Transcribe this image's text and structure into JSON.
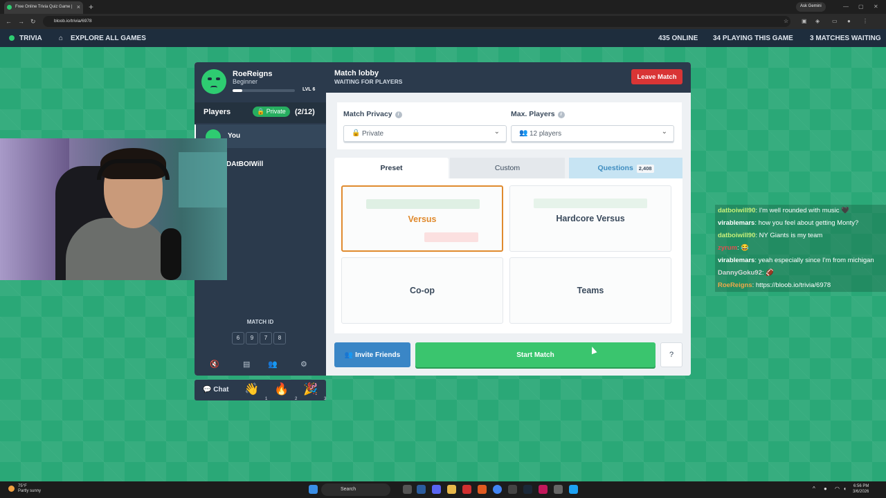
{
  "browser": {
    "tab_title": "Free Online Trivia Quiz Game | ",
    "url": "bloob.io/trivia/6978",
    "gemini_label": "Ask Gemini"
  },
  "site_header": {
    "brand": "TRIVIA",
    "explore": "EXPLORE ALL GAMES",
    "online": "435 ONLINE",
    "playing": "34 PLAYING THIS GAME",
    "waiting": "3 MATCHES WAITING"
  },
  "profile": {
    "name": "RoeReigns",
    "rank": "Beginner",
    "level": "LVL 6",
    "xp_fraction": 0.15
  },
  "players": {
    "title": "Players",
    "privacy_badge": "Private",
    "count": "(2/12)",
    "list": [
      {
        "name": "You"
      },
      {
        "name": "DAtBOIWill"
      }
    ]
  },
  "match_id": {
    "label": "MATCH ID",
    "digits": [
      "6",
      "9",
      "7",
      "8"
    ]
  },
  "lobby": {
    "title": "Match lobby",
    "subtitle": "WAITING FOR PLAYERS",
    "leave_label": "Leave Match",
    "privacy_label": "Match Privacy",
    "privacy_value": "Private",
    "max_players_label": "Max. Players",
    "max_players_value": "12 players",
    "tabs": {
      "preset": "Preset",
      "custom": "Custom",
      "questions": "Questions",
      "questions_count": "2,408"
    },
    "modes": [
      {
        "name": "Versus",
        "selected": true
      },
      {
        "name": "Hardcore Versus",
        "selected": false
      },
      {
        "name": "Co-op",
        "selected": false
      },
      {
        "name": "Teams",
        "selected": false
      }
    ],
    "invite_label": "Invite Friends",
    "start_label": "Start Match",
    "help_label": "?"
  },
  "chat_bar": {
    "chat_label": "Chat",
    "reactions": [
      {
        "emoji": "👋",
        "key": "1"
      },
      {
        "emoji": "🔥",
        "key": "2"
      },
      {
        "emoji": "🎉",
        "key": "3"
      }
    ]
  },
  "stream_chat": [
    {
      "user": "datboiwill90",
      "text": ": I'm well rounded with music 🖤",
      "color": "#c8f07a"
    },
    {
      "user": "virablemars",
      "text": ": how you feel about getting Monty?",
      "color": "#ffffff"
    },
    {
      "user": "datboiwill90",
      "text": ": NY Giants is my team",
      "color": "#c8f07a"
    },
    {
      "user": "zyrum",
      "text": ": 😂",
      "color": "#e05050"
    },
    {
      "user": "virablemars",
      "text": ": yeah especially since I'm from michigan",
      "color": "#ffffff"
    },
    {
      "user": "DannyGoku92",
      "text": ": 🏈",
      "color": "#d8d8d8"
    },
    {
      "user": "RoeReigns",
      "text": ": https://bloob.io/trivia/6978",
      "color": "#f0a84a"
    }
  ],
  "taskbar": {
    "weather_temp": "75°F",
    "weather_desc": "Partly sunny",
    "search": "Search",
    "time": "6:56 PM",
    "date": "3/6/2026"
  },
  "colors": {
    "background": "#2aa877",
    "panel": "#2b3a4c",
    "accent_green": "#3ac56e",
    "leave_red": "#d93535",
    "invite_blue": "#3a86c6",
    "selected_mode": "#e08a2e"
  }
}
